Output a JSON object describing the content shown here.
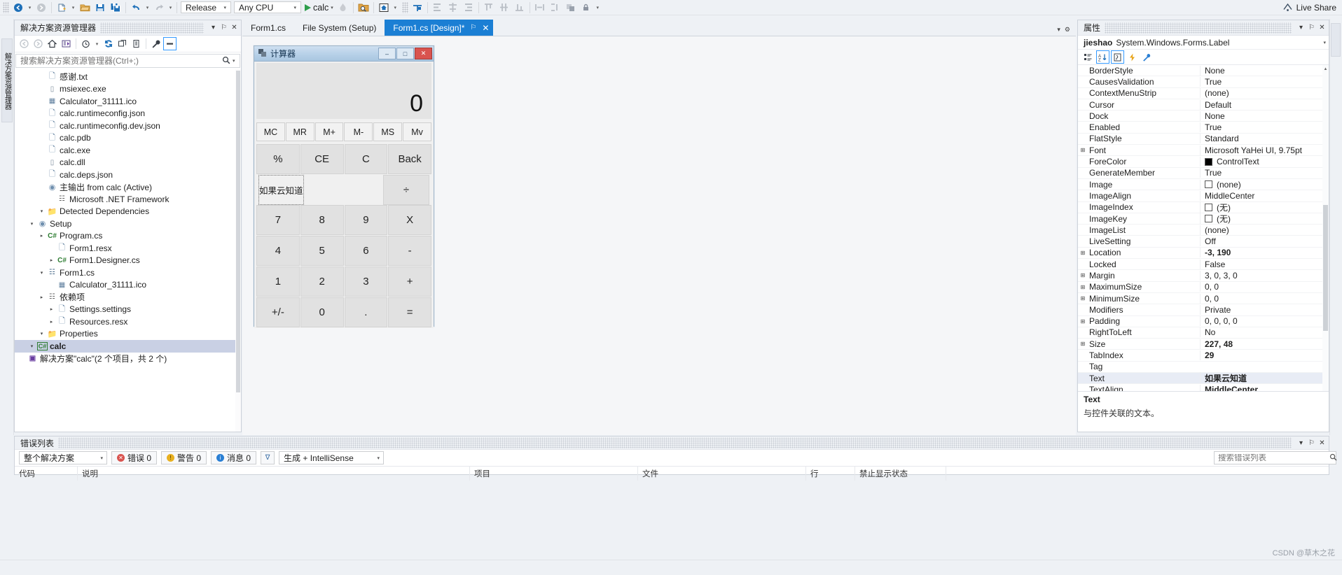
{
  "toolbar": {
    "config_combo": {
      "value": "Release",
      "arrow": "▾"
    },
    "platform_combo": {
      "value": "Any CPU",
      "arrow": "▾"
    },
    "run_label": "calc",
    "run_arrow": "▾",
    "live_share": "Live Share",
    "icons": {
      "nav_back": "◀",
      "nav_forward": "▶",
      "new_item": "❐",
      "open": "Ὄ1",
      "save": "Ὃe",
      "save_all": "὚b",
      "undo": "↶",
      "redo": "↷",
      "hot_reload": "ὒ5",
      "find": "ὐd",
      "home": "⌂",
      "align": "┼"
    }
  },
  "solution_explorer": {
    "title": "解决方案资源管理器",
    "rail_label": "解决方案资源管理器",
    "search_placeholder": "搜索解决方案资源管理器(Ctrl+;)",
    "search_value": "",
    "header_icons": {
      "dropdown": "▾",
      "pin": "⚐",
      "close": "✕"
    },
    "tools": [
      "◀",
      "▶",
      "⌂",
      "☰",
      "◔",
      "↻",
      "❐",
      "❐",
      "ὒ7",
      "▬"
    ],
    "tree": [
      {
        "indent": 0,
        "expander": "",
        "icon": "sln",
        "label": "解决方案\"calc\"(2 个项目，共 2 个)",
        "bold": false,
        "selected": false
      },
      {
        "indent": 1,
        "expander": "▾",
        "icon": "cs",
        "label": "calc",
        "bold": true,
        "selected": true
      },
      {
        "indent": 2,
        "expander": "▾",
        "icon": "folder",
        "label": "Properties",
        "bold": false,
        "selected": false
      },
      {
        "indent": 3,
        "expander": "▸",
        "icon": "file",
        "label": "Resources.resx",
        "bold": false,
        "selected": false
      },
      {
        "indent": 3,
        "expander": "▸",
        "icon": "file",
        "label": "Settings.settings",
        "bold": false,
        "selected": false
      },
      {
        "indent": 2,
        "expander": "▸",
        "icon": "dep",
        "label": "依赖项",
        "bold": false,
        "selected": false
      },
      {
        "indent": 3,
        "expander": "",
        "icon": "ico",
        "label": "Calculator_31111.ico",
        "bold": false,
        "selected": false
      },
      {
        "indent": 2,
        "expander": "▾",
        "icon": "form",
        "label": "Form1.cs",
        "bold": false,
        "selected": false
      },
      {
        "indent": 3,
        "expander": "▸",
        "icon": "cs2",
        "label": "Form1.Designer.cs",
        "bold": false,
        "selected": false
      },
      {
        "indent": 3,
        "expander": "",
        "icon": "file",
        "label": "Form1.resx",
        "bold": false,
        "selected": false
      },
      {
        "indent": 2,
        "expander": "▸",
        "icon": "cs2",
        "label": "Program.cs",
        "bold": false,
        "selected": false
      },
      {
        "indent": 1,
        "expander": "▾",
        "icon": "setup",
        "label": "Setup",
        "bold": false,
        "selected": false
      },
      {
        "indent": 2,
        "expander": "▾",
        "icon": "folder",
        "label": "Detected Dependencies",
        "bold": false,
        "selected": false
      },
      {
        "indent": 3,
        "expander": "",
        "icon": "dep",
        "label": "Microsoft .NET Framework",
        "bold": false,
        "selected": false
      },
      {
        "indent": 2,
        "expander": "",
        "icon": "setup",
        "label": "主输出 from calc (Active)",
        "bold": false,
        "selected": false
      },
      {
        "indent": 2,
        "expander": "",
        "icon": "file",
        "label": "calc.deps.json",
        "bold": false,
        "selected": false
      },
      {
        "indent": 2,
        "expander": "",
        "icon": "dll",
        "label": "calc.dll",
        "bold": false,
        "selected": false
      },
      {
        "indent": 2,
        "expander": "",
        "icon": "file",
        "label": "calc.exe",
        "bold": false,
        "selected": false
      },
      {
        "indent": 2,
        "expander": "",
        "icon": "file",
        "label": "calc.pdb",
        "bold": false,
        "selected": false
      },
      {
        "indent": 2,
        "expander": "",
        "icon": "file",
        "label": "calc.runtimeconfig.dev.json",
        "bold": false,
        "selected": false
      },
      {
        "indent": 2,
        "expander": "",
        "icon": "file",
        "label": "calc.runtimeconfig.json",
        "bold": false,
        "selected": false
      },
      {
        "indent": 2,
        "expander": "",
        "icon": "ico",
        "label": "Calculator_31111.ico",
        "bold": false,
        "selected": false
      },
      {
        "indent": 2,
        "expander": "",
        "icon": "dll",
        "label": "msiexec.exe",
        "bold": false,
        "selected": false
      },
      {
        "indent": 2,
        "expander": "",
        "icon": "file",
        "label": "感谢.txt",
        "bold": false,
        "selected": false
      }
    ]
  },
  "editor_tabs": {
    "tabs": [
      {
        "label": "Form1.cs",
        "active": false
      },
      {
        "label": "File System (Setup)",
        "active": false
      },
      {
        "label": "Form1.cs [Design]*",
        "active": true,
        "pin": "⚐",
        "close": "✕"
      }
    ],
    "right_icons": {
      "dropdown": "▾",
      "gear": "⚙"
    }
  },
  "designer": {
    "form": {
      "title": "计算器",
      "icon": "window-icon",
      "minimize": "–",
      "maximize": "□",
      "close": "✕",
      "display_value": "0",
      "memory_buttons": [
        "MC",
        "MR",
        "M+",
        "M-",
        "MS",
        "Mv"
      ],
      "rows": [
        [
          "%",
          "CE",
          "C",
          "Back"
        ],
        [
          "如果云知道",
          "÷"
        ],
        [
          "7",
          "8",
          "9",
          "X"
        ],
        [
          "4",
          "5",
          "6",
          "-"
        ],
        [
          "1",
          "2",
          "3",
          "+"
        ],
        [
          "+/-",
          "0",
          ".",
          "="
        ]
      ],
      "selected_label_text": "如果云知道",
      "divide_button": "÷"
    }
  },
  "properties": {
    "title": "属性",
    "rail_label": "properties-rail",
    "object_name": "jieshao",
    "object_type": "System.Windows.Forms.Label",
    "header_icons": {
      "dropdown": "▾",
      "pin": "⚐",
      "close": "✕"
    },
    "tools": [
      "☰",
      "A↓",
      "❐",
      "⚡",
      "ὒ7"
    ],
    "rows": [
      {
        "expander": "",
        "name": "BorderStyle",
        "value": "None",
        "bold": false,
        "swatch": ""
      },
      {
        "expander": "",
        "name": "CausesValidation",
        "value": "True",
        "bold": false,
        "swatch": ""
      },
      {
        "expander": "",
        "name": "ContextMenuStrip",
        "value": "(none)",
        "bold": false,
        "swatch": ""
      },
      {
        "expander": "",
        "name": "Cursor",
        "value": "Default",
        "bold": false,
        "swatch": ""
      },
      {
        "expander": "",
        "name": "Dock",
        "value": "None",
        "bold": false,
        "swatch": ""
      },
      {
        "expander": "",
        "name": "Enabled",
        "value": "True",
        "bold": false,
        "swatch": ""
      },
      {
        "expander": "",
        "name": "FlatStyle",
        "value": "Standard",
        "bold": false,
        "swatch": ""
      },
      {
        "expander": "⊞",
        "name": "Font",
        "value": "Microsoft YaHei UI, 9.75pt",
        "bold": false,
        "swatch": ""
      },
      {
        "expander": "",
        "name": "ForeColor",
        "value": "ControlText",
        "bold": false,
        "swatch": "#000000"
      },
      {
        "expander": "",
        "name": "GenerateMember",
        "value": "True",
        "bold": false,
        "swatch": ""
      },
      {
        "expander": "",
        "name": "Image",
        "value": "(none)",
        "bold": false,
        "swatch": "#ffffff"
      },
      {
        "expander": "",
        "name": "ImageAlign",
        "value": "MiddleCenter",
        "bold": false,
        "swatch": ""
      },
      {
        "expander": "",
        "name": "ImageIndex",
        "value": "(无)",
        "bold": false,
        "swatch": "#ffffff"
      },
      {
        "expander": "",
        "name": "ImageKey",
        "value": "(无)",
        "bold": false,
        "swatch": "#ffffff"
      },
      {
        "expander": "",
        "name": "ImageList",
        "value": "(none)",
        "bold": false,
        "swatch": ""
      },
      {
        "expander": "",
        "name": "LiveSetting",
        "value": "Off",
        "bold": false,
        "swatch": ""
      },
      {
        "expander": "⊞",
        "name": "Location",
        "value": "-3, 190",
        "bold": true,
        "swatch": ""
      },
      {
        "expander": "",
        "name": "Locked",
        "value": "False",
        "bold": false,
        "swatch": ""
      },
      {
        "expander": "⊞",
        "name": "Margin",
        "value": "3, 0, 3, 0",
        "bold": false,
        "swatch": ""
      },
      {
        "expander": "⊞",
        "name": "MaximumSize",
        "value": "0, 0",
        "bold": false,
        "swatch": ""
      },
      {
        "expander": "⊞",
        "name": "MinimumSize",
        "value": "0, 0",
        "bold": false,
        "swatch": ""
      },
      {
        "expander": "",
        "name": "Modifiers",
        "value": "Private",
        "bold": false,
        "swatch": ""
      },
      {
        "expander": "⊞",
        "name": "Padding",
        "value": "0, 0, 0, 0",
        "bold": false,
        "swatch": ""
      },
      {
        "expander": "",
        "name": "RightToLeft",
        "value": "No",
        "bold": false,
        "swatch": ""
      },
      {
        "expander": "⊞",
        "name": "Size",
        "value": "227, 48",
        "bold": true,
        "swatch": ""
      },
      {
        "expander": "",
        "name": "TabIndex",
        "value": "29",
        "bold": true,
        "swatch": ""
      },
      {
        "expander": "",
        "name": "Tag",
        "value": "",
        "bold": false,
        "swatch": ""
      },
      {
        "expander": "",
        "name": "Text",
        "value": "如果云知道",
        "bold": true,
        "swatch": "",
        "selected": true
      },
      {
        "expander": "",
        "name": "TextAlign",
        "value": "MiddleCenter",
        "bold": true,
        "swatch": ""
      }
    ],
    "description": {
      "title": "Text",
      "text": "与控件关联的文本。"
    },
    "scroll": {
      "up": "▲",
      "down": "▼"
    }
  },
  "error_list": {
    "title": "错误列表",
    "header_icons": {
      "dropdown": "▾",
      "pin": "⚐",
      "close": "✕"
    },
    "scope_combo": {
      "value": "整个解决方案",
      "arrow": "▾"
    },
    "errors": {
      "label": "错误 0",
      "glyph": "✕"
    },
    "warnings": {
      "label": "警告 0",
      "glyph": "!"
    },
    "messages": {
      "label": "消息 0",
      "glyph": "i"
    },
    "filter_glyph": "∇",
    "build_combo": {
      "value": "生成 + IntelliSense",
      "arrow": "▾"
    },
    "search_placeholder": "搜索错误列表",
    "search_value": "",
    "columns": [
      "代码",
      "说明",
      "项目",
      "文件",
      "行",
      "禁止显示状态"
    ]
  },
  "status_bar": {
    "left": "",
    "watermark": "CSDN @草木之花"
  }
}
